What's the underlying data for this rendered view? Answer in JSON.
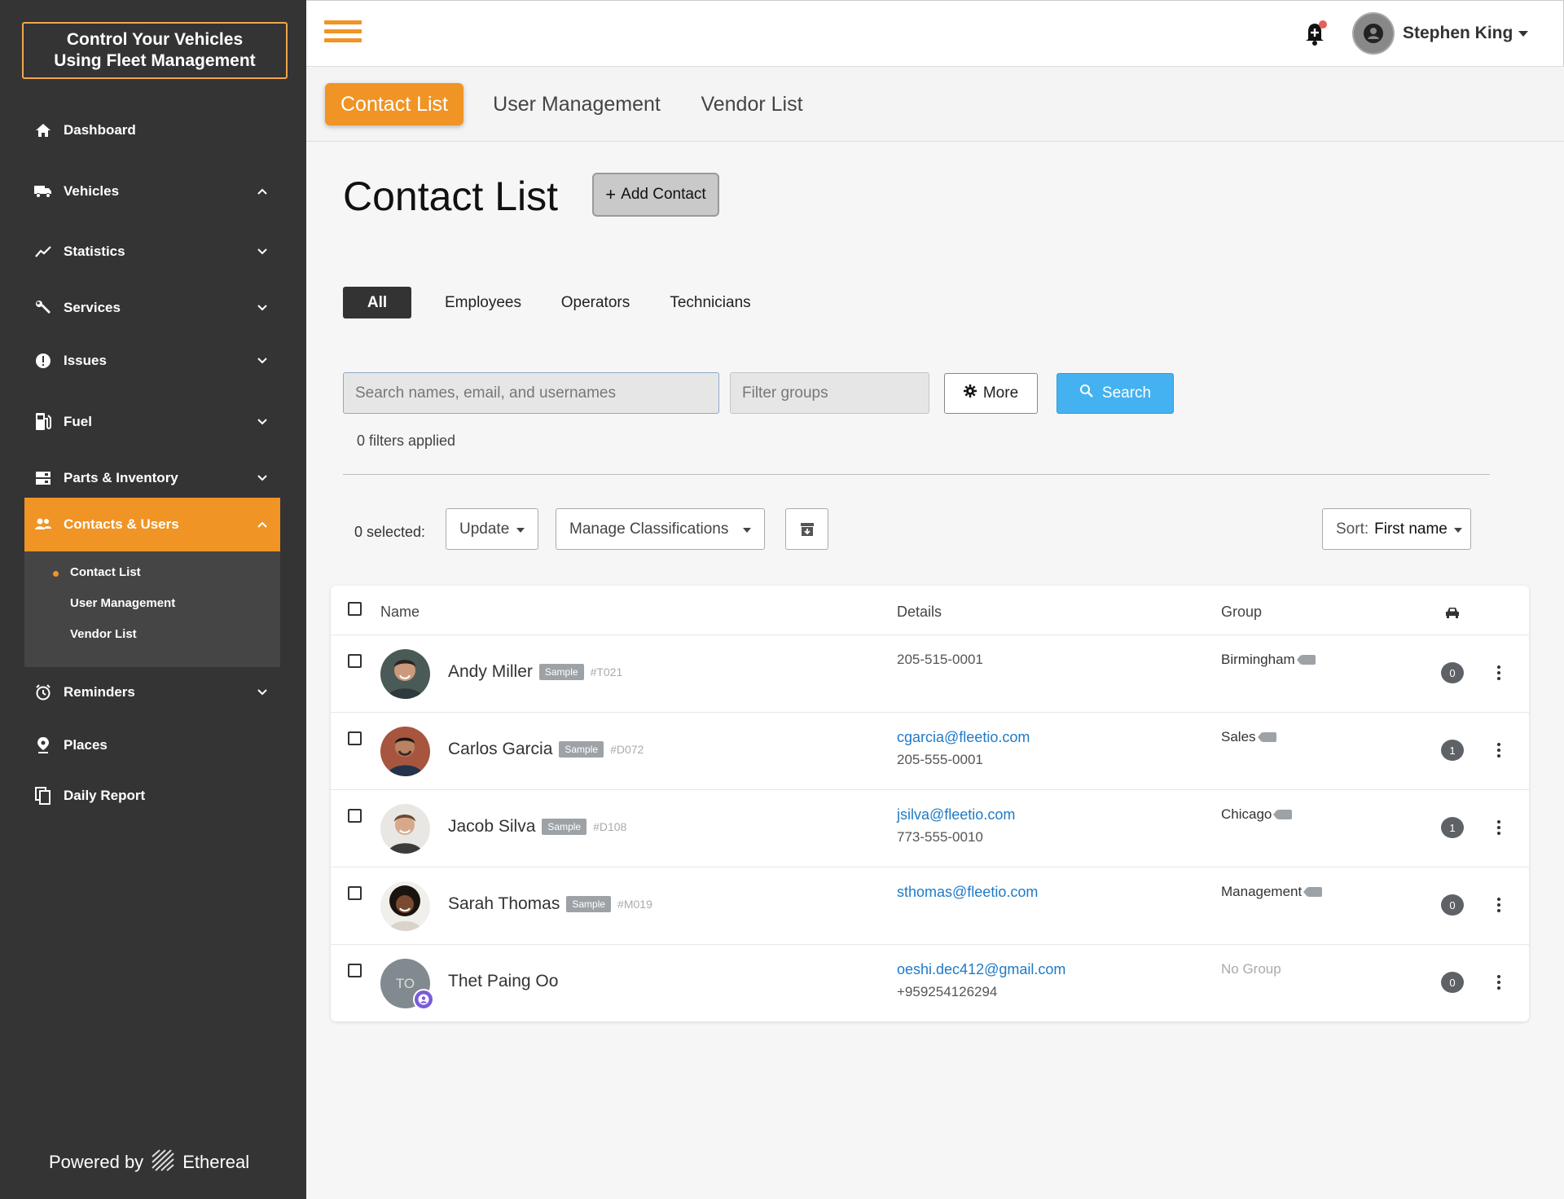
{
  "brand": {
    "line1": "Control Your Vehicles",
    "line2": "Using Fleet Management"
  },
  "sidebar": {
    "items": [
      {
        "label": "Dashboard",
        "icon": "home-icon"
      },
      {
        "label": "Vehicles",
        "icon": "truck-icon",
        "expanded": true
      },
      {
        "label": "Statistics",
        "icon": "chart-line-icon"
      },
      {
        "label": "Services",
        "icon": "wrench-icon"
      },
      {
        "label": "Issues",
        "icon": "alert-circle-icon"
      },
      {
        "label": "Fuel",
        "icon": "fuel-pump-icon"
      },
      {
        "label": "Parts & Inventory",
        "icon": "inventory-icon"
      },
      {
        "label": "Contacts & Users",
        "icon": "users-icon",
        "active": true,
        "expanded": true
      },
      {
        "label": "Reminders",
        "icon": "alarm-clock-icon"
      },
      {
        "label": "Places",
        "icon": "map-pin-icon"
      },
      {
        "label": "Daily Report",
        "icon": "copy-icon"
      }
    ],
    "subitems": [
      "Contact List",
      "User Management",
      "Vendor List"
    ],
    "powered_by": "Powered by",
    "powered_brand": "Ethereal"
  },
  "header": {
    "user_name": "Stephen King"
  },
  "top_tabs": [
    "Contact List",
    "User Management",
    "Vendor List"
  ],
  "page": {
    "title": "Contact List",
    "add_button": "Add Contact",
    "filter_tabs": [
      "All",
      "Employees",
      "Operators",
      "Technicians"
    ],
    "search_placeholder": "Search names, email, and usernames",
    "filter_placeholder": "Filter groups",
    "more_label": "More",
    "search_label": "Search",
    "filters_applied": "0 filters applied",
    "selected_label": "0 selected:",
    "update_label": "Update",
    "manage_label": "Manage Classifications",
    "sort_prefix": "Sort:",
    "sort_value": "First name"
  },
  "table": {
    "headers": {
      "name": "Name",
      "details": "Details",
      "group": "Group"
    },
    "rows": [
      {
        "name": "Andy Miller",
        "sample": "Sample",
        "code": "#T021",
        "email": "",
        "phone": "205-515-0001",
        "group": "Birmingham",
        "count": "0"
      },
      {
        "name": "Carlos Garcia",
        "sample": "Sample",
        "code": "#D072",
        "email": "cgarcia@fleetio.com",
        "phone": "205-555-0001",
        "group": "Sales",
        "count": "1"
      },
      {
        "name": "Jacob Silva",
        "sample": "Sample",
        "code": "#D108",
        "email": "jsilva@fleetio.com",
        "phone": "773-555-0010",
        "group": "Chicago",
        "count": "1"
      },
      {
        "name": "Sarah Thomas",
        "sample": "Sample",
        "code": "#M019",
        "email": "sthomas@fleetio.com",
        "phone": "",
        "group": "Management",
        "count": "0"
      },
      {
        "name": "Thet Paing Oo",
        "initials": "TO",
        "email": "oeshi.dec412@gmail.com",
        "phone": "+959254126294",
        "group": "No Group",
        "count": "0"
      }
    ]
  },
  "colors": {
    "accent": "#ef9425",
    "sidebar": "#343434",
    "search": "#44b2f0",
    "link": "#1f7ac6"
  }
}
